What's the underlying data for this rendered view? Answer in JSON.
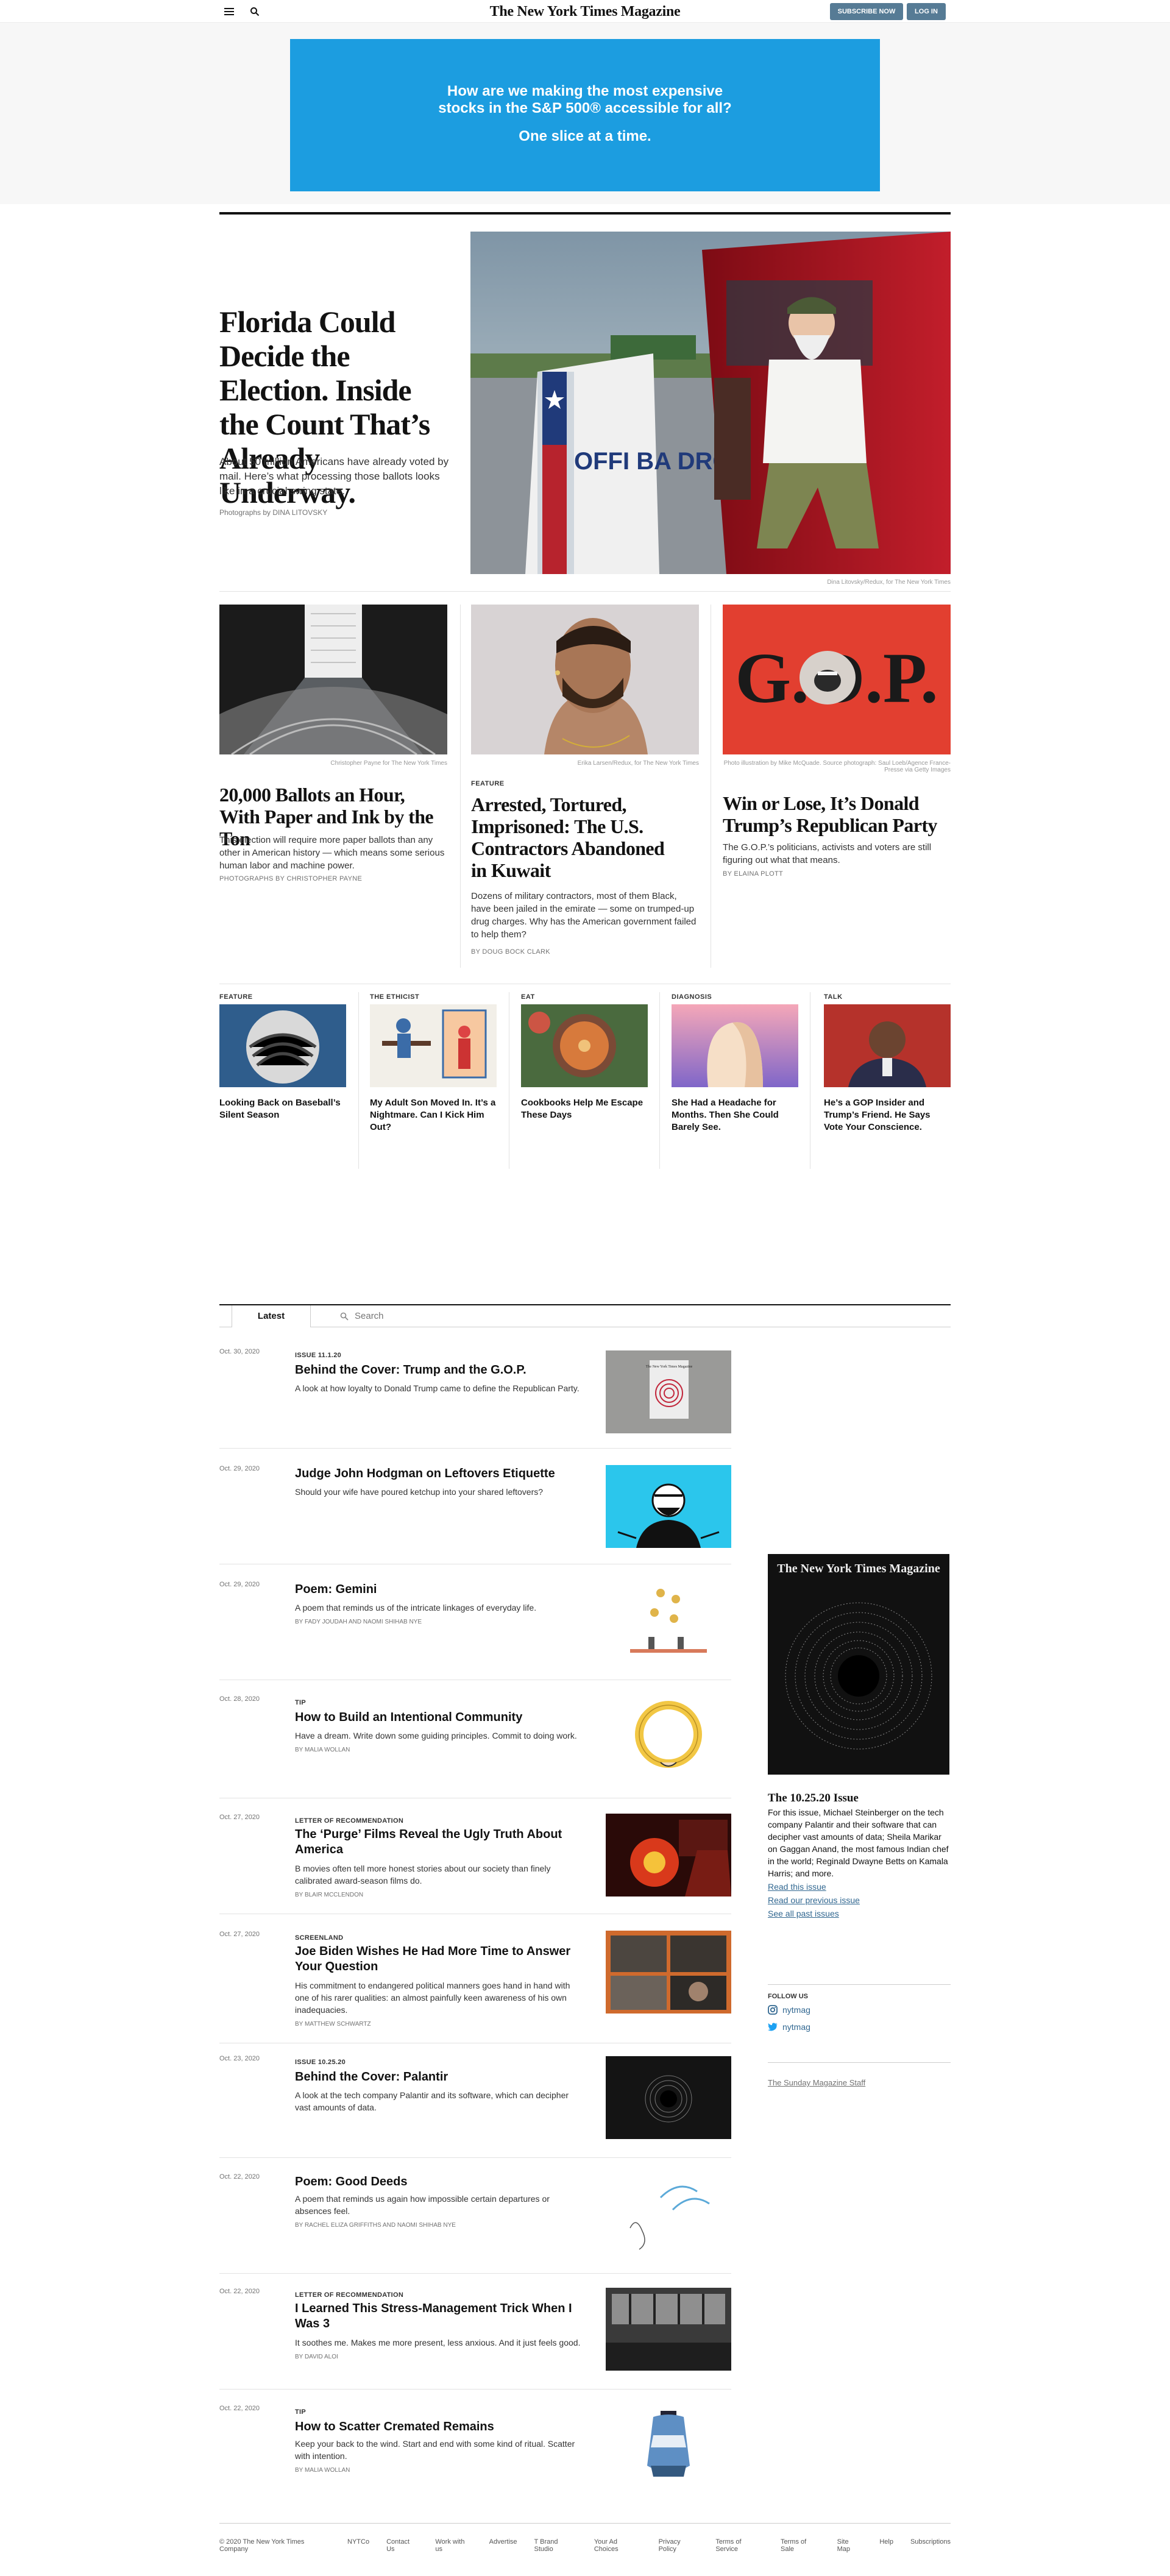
{
  "header": {
    "masthead": "The New York Times Magazine",
    "subscribe_label": "SUBSCRIBE NOW",
    "login_label": "LOG IN",
    "menu_icon": "hamburger-icon",
    "search_icon": "search-icon"
  },
  "ad": {
    "line1": "How are we making the most expensive",
    "line2": "stocks in the S&P 500® accessible for all?",
    "line3": "One slice at a time.",
    "color": "#1c9de0"
  },
  "hero": {
    "title": "Florida Could Decide the Election. Inside the Count That’s Already Underway.",
    "summary": "About 50 million Americans have already voted by mail. Here’s what processing those ballots looks like in a crucial swing state.",
    "credit": "Photographs by DINA LITOVSKY",
    "caption": "Dina Litovsky/Redux, for The New York Times",
    "sign_text": "OFFI BA DROP"
  },
  "features": [
    {
      "kicker": "",
      "title": "20,000 Ballots an Hour, With Paper and Ink by the Ton",
      "summary": "This election will require more paper ballots than any other in American history — which means some serious human labor and machine power.",
      "byline": "Photographs by CHRISTOPHER PAYNE",
      "caption": "Christopher Payne for The New York Times"
    },
    {
      "kicker": "FEATURE",
      "title": "Arrested, Tortured, Imprisoned: The U.S. Contractors Abandoned in Kuwait",
      "summary": "Dozens of military contractors, most of them Black, have been jailed in the emirate — some on trumped-up drug charges. Why has the American government failed to help them?",
      "byline": "By DOUG BOCK CLARK",
      "caption": "Erika Larsen/Redux, for The New York Times"
    },
    {
      "kicker": "",
      "title": "Win or Lose, It’s Donald Trump’s Republican Party",
      "summary": "The G.O.P.’s politicians, activists and voters are still figuring out what that means.",
      "byline": "By ELAINA PLOTT",
      "caption": "Photo illustration by Mike McQuade. Source photograph: Saul Loeb/Agence France-Presse via Getty Images",
      "art_text": "G.O.P."
    }
  ],
  "small_cards": [
    {
      "kicker": "FEATURE",
      "title": "Looking Back on Baseball’s Silent Season"
    },
    {
      "kicker": "THE ETHICIST",
      "title": "My Adult Son Moved In. It’s a Nightmare. Can I Kick Him Out?"
    },
    {
      "kicker": "EAT",
      "title": "Cookbooks Help Me Escape These Days"
    },
    {
      "kicker": "DIAGNOSIS",
      "title": "She Had a Headache for Months. Then She Could Barely See."
    },
    {
      "kicker": "TALK",
      "title": "He’s a GOP Insider and Trump’s Friend. He Says Vote Your Conscience."
    }
  ],
  "tabs": {
    "latest": "Latest",
    "search_placeholder": "Search"
  },
  "stream": [
    {
      "date": "Oct. 30, 2020",
      "kicker": "ISSUE 11.1.20",
      "title": "Behind the Cover: Trump and the G.O.P.",
      "summary": "A look at how loyalty to Donald Trump came to define the Republican Party.",
      "byline": ""
    },
    {
      "date": "Oct. 29, 2020",
      "kicker": "",
      "title": "Judge John Hodgman on Leftovers Etiquette",
      "summary": "Should your wife have poured ketchup into your shared leftovers?",
      "byline": ""
    },
    {
      "date": "Oct. 29, 2020",
      "kicker": "",
      "title": "Poem: Gemini",
      "summary": "A poem that reminds us of the intricate linkages of everyday life.",
      "byline": "By FADY JOUDAH and NAOMI SHIHAB NYE"
    },
    {
      "date": "Oct. 28, 2020",
      "kicker": "TIP",
      "title": "How to Build an Intentional Community",
      "summary": "Have a dream. Write down some guiding principles. Commit to doing work.",
      "byline": "By MALIA WOLLAN"
    },
    {
      "date": "Oct. 27, 2020",
      "kicker": "LETTER OF RECOMMENDATION",
      "title": "The ‘Purge’ Films Reveal the Ugly Truth About America",
      "summary": "B movies often tell more honest stories about our society than finely calibrated award-season films do.",
      "byline": "By BLAIR MCCLENDON"
    },
    {
      "date": "Oct. 27, 2020",
      "kicker": "SCREENLAND",
      "title": "Joe Biden Wishes He Had More Time to Answer Your Question",
      "summary": "His commitment to endangered political manners goes hand in hand with one of his rarer qualities: an almost painfully keen awareness of his own inadequacies.",
      "byline": "By MATTHEW SCHWARTZ"
    },
    {
      "date": "Oct. 23, 2020",
      "kicker": "ISSUE 10.25.20",
      "title": "Behind the Cover: Palantir",
      "summary": "A look at the tech company Palantir and its software, which can decipher vast amounts of data.",
      "byline": ""
    },
    {
      "date": "Oct. 22, 2020",
      "kicker": "",
      "title": "Poem: Good Deeds",
      "summary": "A poem that reminds us again how impossible certain departures or absences feel.",
      "byline": "By RACHEL ELIZA GRIFFITHS and NAOMI SHIHAB NYE"
    },
    {
      "date": "Oct. 22, 2020",
      "kicker": "LETTER OF RECOMMENDATION",
      "title": "I Learned This Stress-Management Trick When I Was 3",
      "summary": "It soothes me. Makes me more present, less anxious. And it just feels good.",
      "byline": "By DAVID ALOI"
    },
    {
      "date": "Oct. 22, 2020",
      "kicker": "TIP",
      "title": "How to Scatter Cremated Remains",
      "summary": "Keep your back to the wind. Start and end with some kind of ritual. Scatter with intention.",
      "byline": "By MALIA WOLLAN"
    }
  ],
  "thumb1_text": "The New York Times Magazine",
  "rail": {
    "cover_masthead": "The New York Times Magazine",
    "issue_title": "The 10.25.20 Issue",
    "summary": "For this issue, Michael Steinberger on the tech company Palantir and their software that can decipher vast amounts of data; Sheila Marikar on Gaggan Anand, the most famous Indian chef in the world; Reginald Dwayne Betts on Kamala Harris; and more.",
    "links": [
      "Read this issue",
      "Read our previous issue",
      "See all past issues"
    ],
    "follow_label": "FOLLOW US",
    "instagram": "nytmag",
    "twitter": "nytmag",
    "staff_link": "The Sunday Magazine Staff"
  },
  "footer": {
    "links": [
      "© 2020 The New York Times Company",
      "NYTCo",
      "Contact Us",
      "Work with us",
      "Advertise",
      "T Brand Studio",
      "Your Ad Choices",
      "Privacy Policy",
      "Terms of Service",
      "Terms of Sale",
      "Site Map",
      "Help",
      "Subscriptions"
    ]
  }
}
